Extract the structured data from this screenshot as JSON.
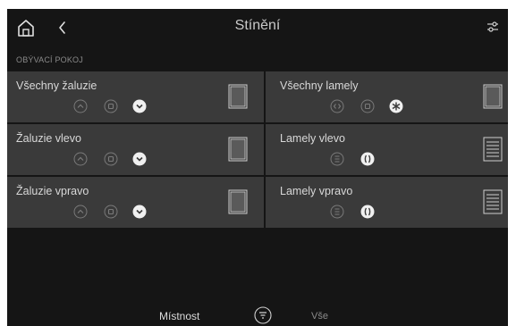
{
  "header": {
    "title": "Stínění"
  },
  "room": {
    "label": "OBÝVACÍ POKOJ"
  },
  "tiles": [
    {
      "label": "Všechny žaluzie"
    },
    {
      "label": "Všechny lamely"
    },
    {
      "label": "Žaluzie vlevo"
    },
    {
      "label": "Lamely vlevo"
    },
    {
      "label": "Žaluzie vpravo"
    },
    {
      "label": "Lamely vpravo"
    }
  ],
  "bottom": {
    "room_tab": "Místnost",
    "all_tab": "Vše"
  },
  "colors": {
    "background": "#151515",
    "tile": "#3a3a3a",
    "text": "#d8d8d8",
    "muted": "#8a8a8a"
  }
}
